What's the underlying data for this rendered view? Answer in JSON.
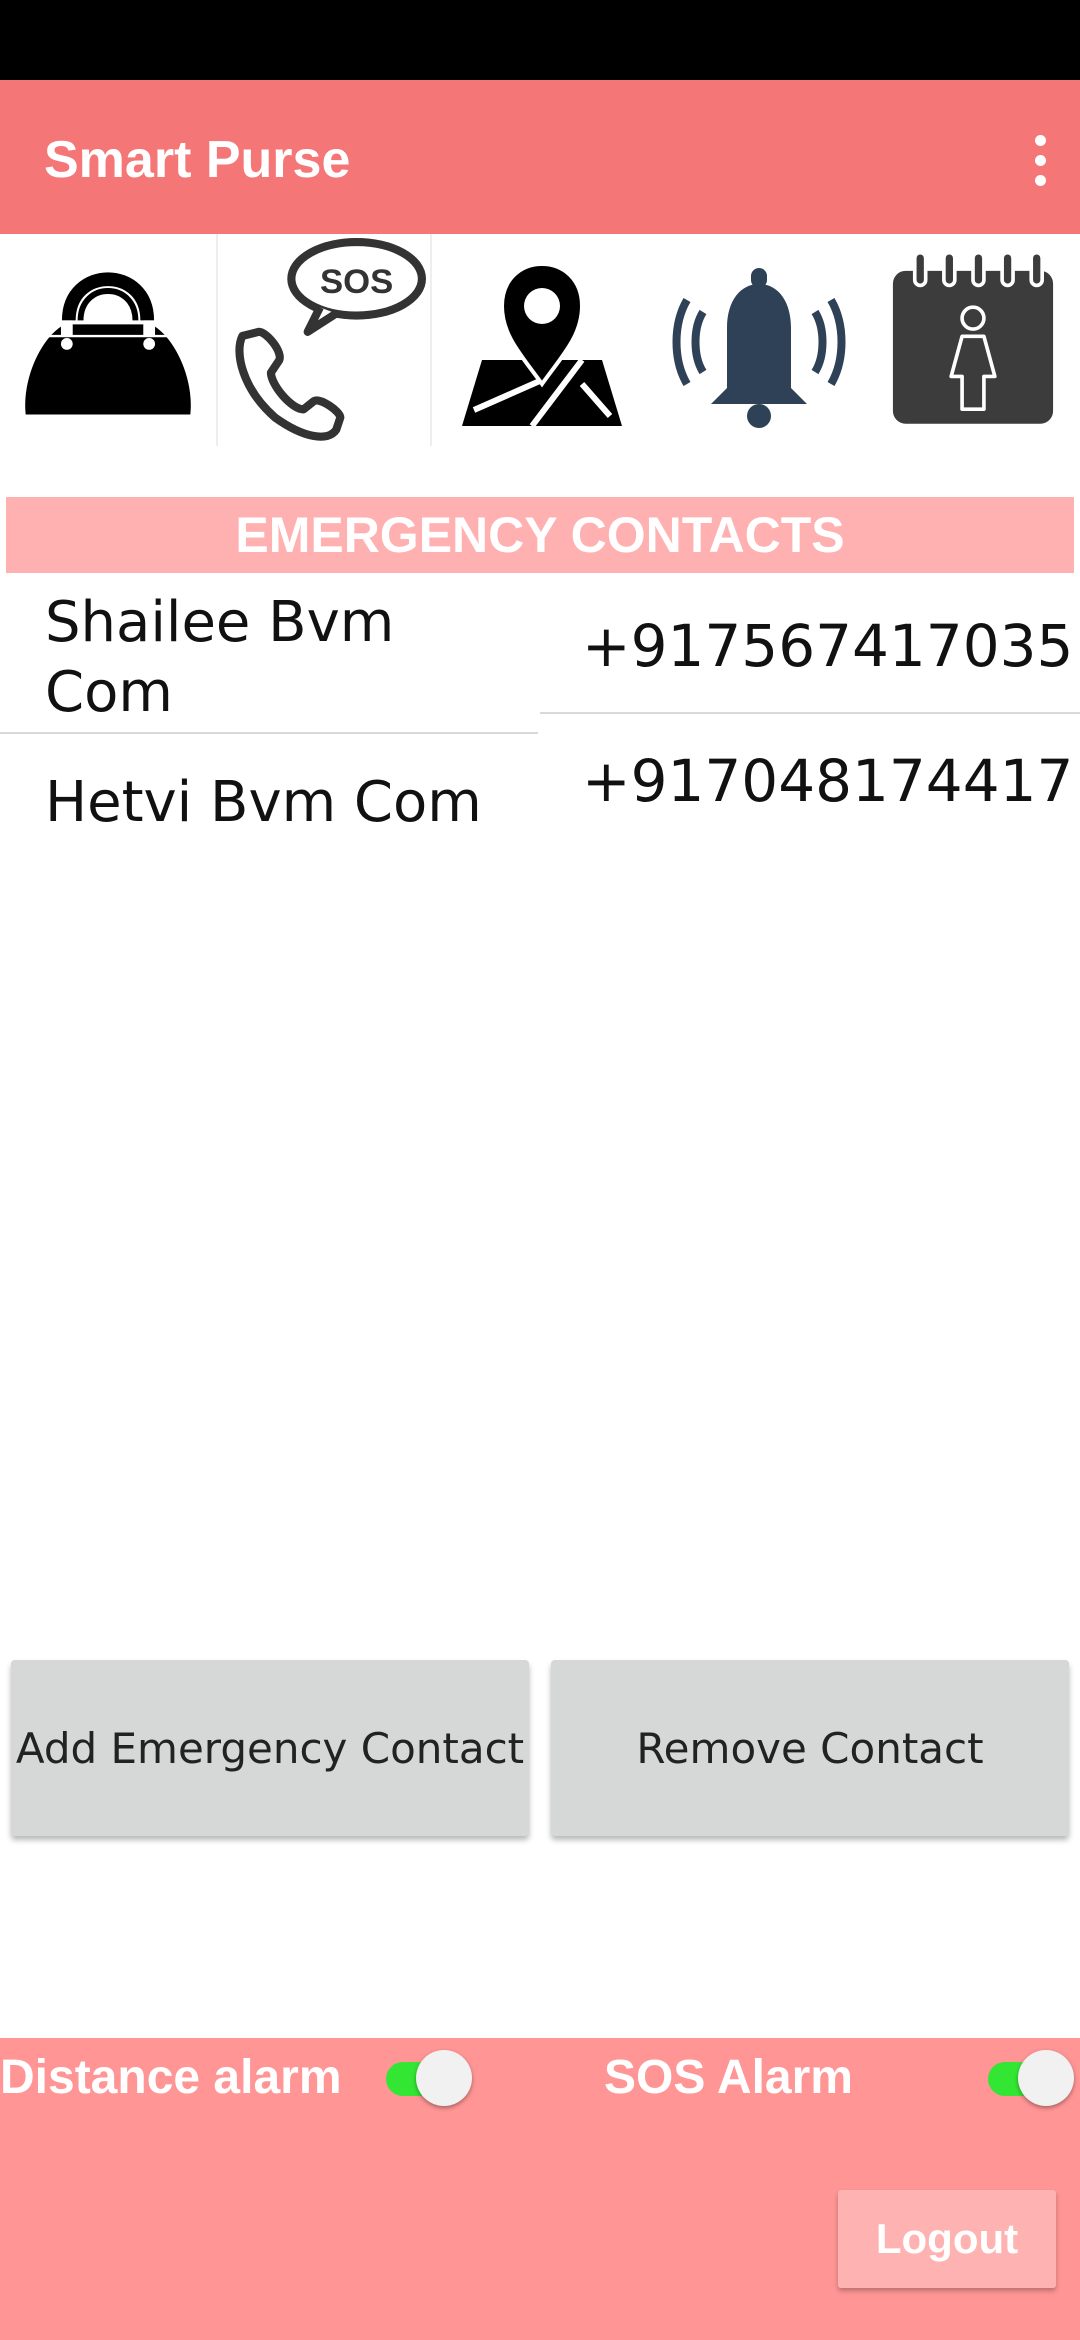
{
  "app": {
    "title": "Smart Purse"
  },
  "icons": [
    {
      "name": "purse-icon"
    },
    {
      "name": "sos-call-icon",
      "label": "SOS"
    },
    {
      "name": "map-location-icon"
    },
    {
      "name": "alarm-bell-icon"
    },
    {
      "name": "calendar-woman-icon"
    }
  ],
  "section": {
    "title": "EMERGENCY CONTACTS"
  },
  "contacts": [
    {
      "name_line1": "Shailee Bvm",
      "name_line2": "Com",
      "phone": "+917567417035"
    },
    {
      "name_line1": "Hetvi Bvm Com",
      "phone": "+917048174417"
    }
  ],
  "buttons": {
    "add": "Add Emergency Contact",
    "remove": "Remove Contact",
    "logout": "Logout"
  },
  "toggles": {
    "distance": {
      "label": "Distance alarm",
      "on": true
    },
    "sos": {
      "label": "SOS Alarm",
      "on": true
    }
  },
  "colors": {
    "app_bar": "#f47676",
    "section_header": "#ffb0b0",
    "bottom_panel": "#ff9595",
    "switch_on": "#33e633",
    "bell": "#2e4156"
  }
}
